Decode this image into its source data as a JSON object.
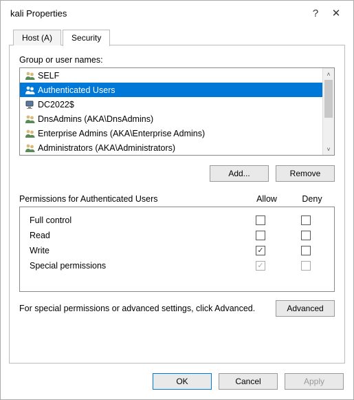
{
  "title": "kali Properties",
  "tabs": {
    "host": "Host (A)",
    "security": "Security"
  },
  "group_label": "Group or user names:",
  "principals": [
    {
      "name": "SELF",
      "type": "group"
    },
    {
      "name": "Authenticated Users",
      "type": "group",
      "selected": true
    },
    {
      "name": "DC2022$",
      "type": "computer"
    },
    {
      "name": "DnsAdmins (AKA\\DnsAdmins)",
      "type": "group"
    },
    {
      "name": "Enterprise Admins (AKA\\Enterprise Admins)",
      "type": "group"
    },
    {
      "name": "Administrators (AKA\\Administrators)",
      "type": "group"
    }
  ],
  "buttons": {
    "add": "Add...",
    "remove": "Remove",
    "advanced": "Advanced",
    "ok": "OK",
    "cancel": "Cancel",
    "apply": "Apply"
  },
  "perm_header": {
    "label": "Permissions for Authenticated Users",
    "allow": "Allow",
    "deny": "Deny"
  },
  "permissions": [
    {
      "name": "Full control",
      "allow": false,
      "deny": false,
      "grey": false
    },
    {
      "name": "Read",
      "allow": false,
      "deny": false,
      "grey": false
    },
    {
      "name": "Write",
      "allow": true,
      "deny": false,
      "grey": false
    },
    {
      "name": "Special permissions",
      "allow": true,
      "deny": false,
      "grey": true
    }
  ],
  "advanced_text": "For special permissions or advanced settings, click Advanced."
}
